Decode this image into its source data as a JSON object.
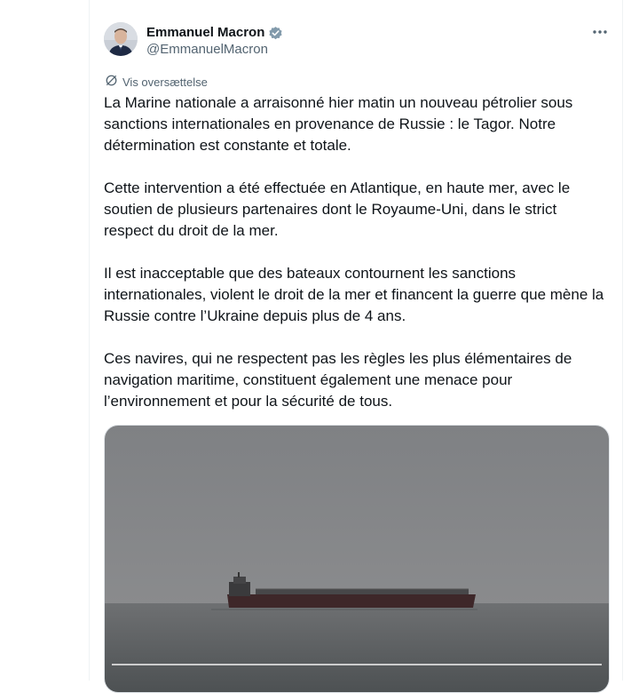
{
  "author": {
    "name": "Emmanuel Macron",
    "handle": "@EmmanuelMacron",
    "verified_color": "#829aab"
  },
  "translate_label": "Vis oversættelse",
  "post": {
    "paragraphs": [
      "La Marine nationale a arraisonné hier matin un nouveau pétrolier sous sanctions internationales en provenance de Russie : le Tagor. Notre détermination est constante et totale.",
      "Cette intervention a été effectuée en Atlantique, en haute mer, avec le soutien de plusieurs partenaires dont le Royaume-Uni, dans le strict respect du droit de la mer.",
      "Il est inacceptable que des bateaux contournent les sanctions internationales, violent le droit de la mer et financent la guerre que mène la Russie contre l’Ukraine depuis plus de 4 ans.",
      "Ces navires, qui ne respectent pas les règles les plus élémentaires de navigation maritime, constituent également une menace pour l’environnement et pour la sécurité de tous."
    ]
  },
  "icons": {
    "more": "more-options-icon",
    "verified": "verified-badge-icon",
    "translate": "globe-icon"
  },
  "colors": {
    "text": "#0f1419",
    "secondary": "#536471"
  }
}
